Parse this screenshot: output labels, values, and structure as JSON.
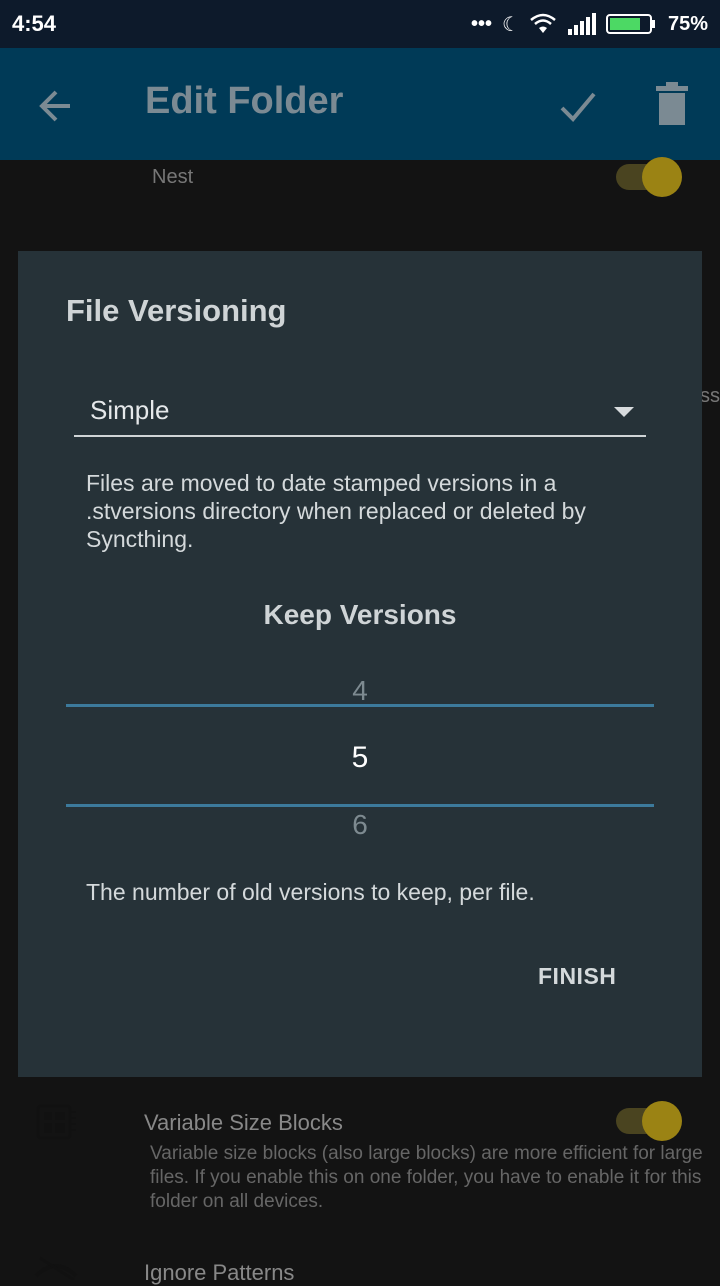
{
  "status_bar": {
    "time": "4:54",
    "battery": "75%"
  },
  "app_bar": {
    "title": "Edit Folder"
  },
  "background": {
    "nest_label": "Nest",
    "partial_text": "ss",
    "variable_blocks": {
      "title": "Variable Size Blocks",
      "description": "Variable size blocks (also large blocks) are more efficient for large files. If you enable this on one folder, you have to enable it for this folder on all devices."
    },
    "ignore_patterns_label": "Ignore Patterns"
  },
  "dialog": {
    "title": "File Versioning",
    "versioning_type": {
      "selected": "Simple"
    },
    "description": "Files are moved to date stamped versions in a .stversions directory when replaced or deleted by Syncthing.",
    "keep_versions_label": "Keep Versions",
    "picker": {
      "previous": "4",
      "current": "5",
      "next": "6"
    },
    "hint": "The number of old versions to keep, per file.",
    "finish_label": "FINISH"
  },
  "colors": {
    "app_bar": "#003a57",
    "dialog": "#263238",
    "accent_line": "#3c7a9c",
    "toggle_knob": "#9b8314"
  }
}
